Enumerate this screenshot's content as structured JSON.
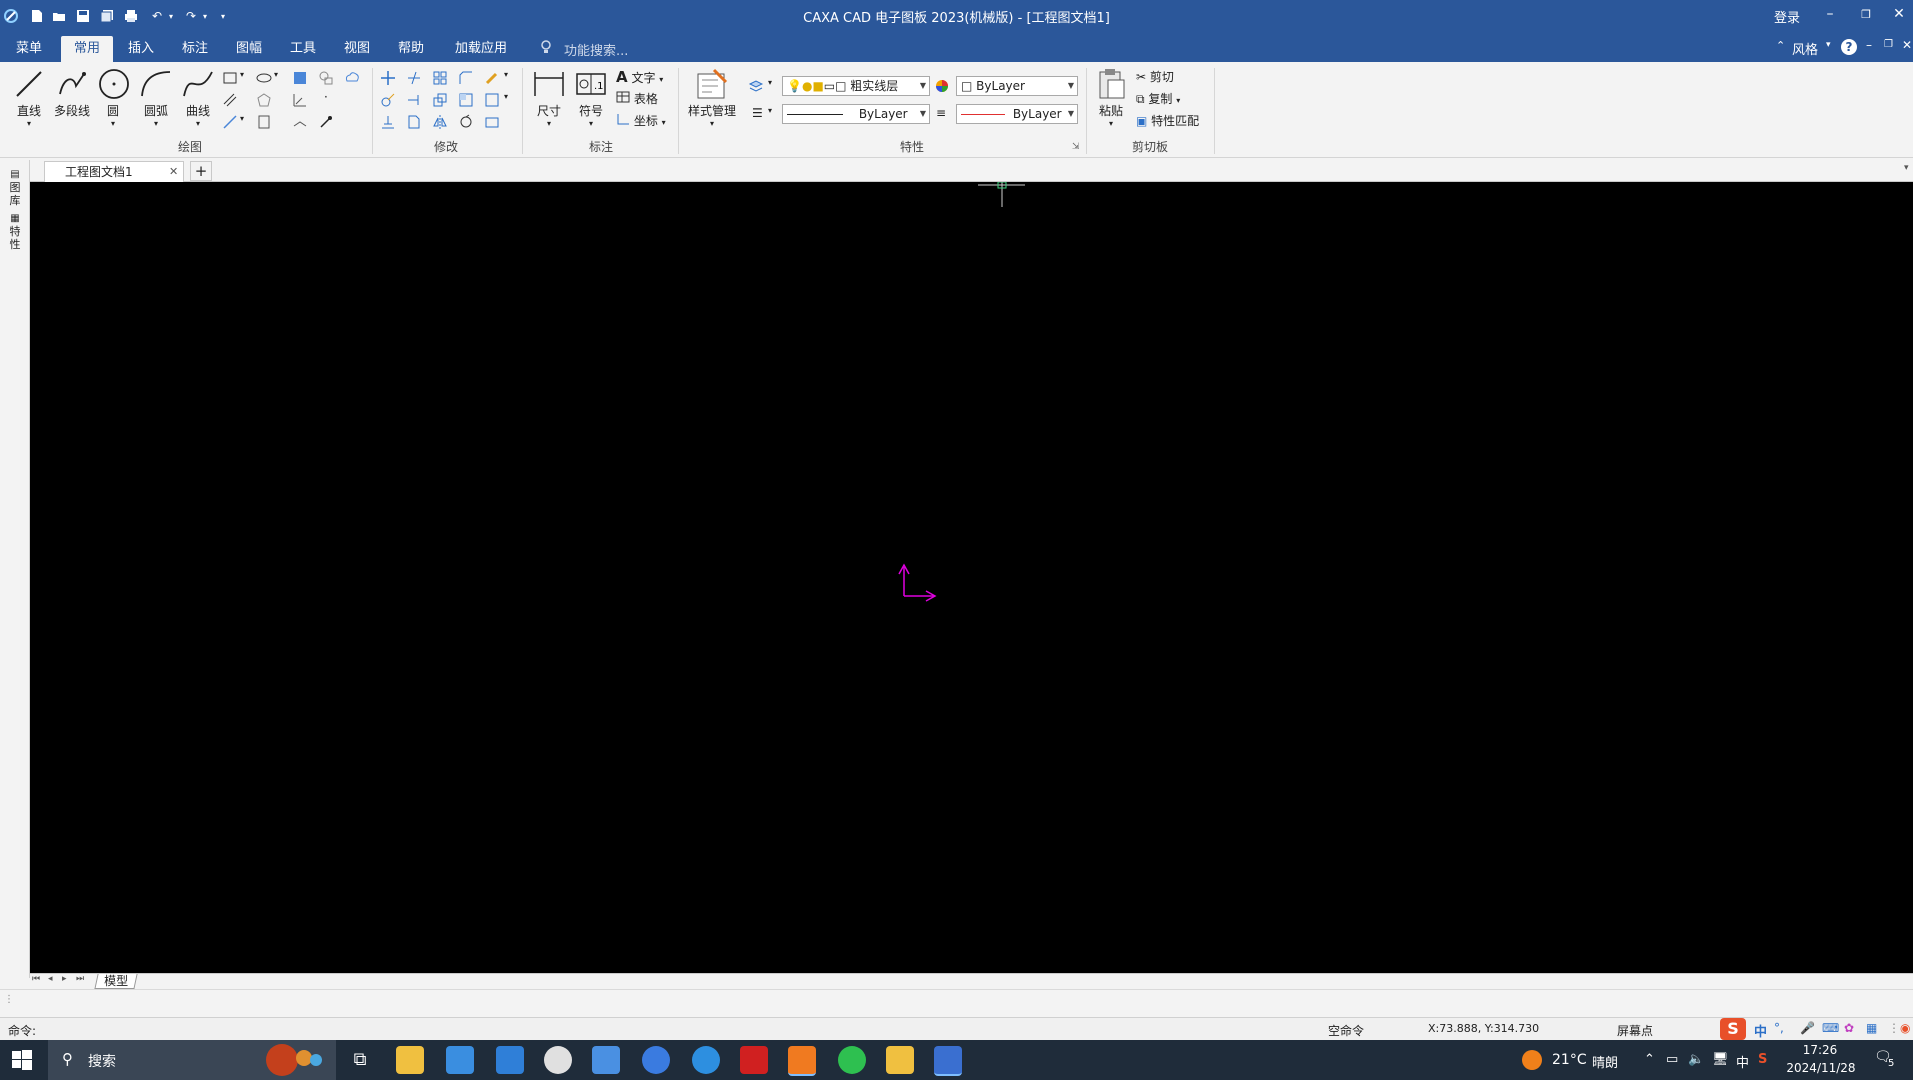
{
  "app": {
    "title": "CAXA CAD 电子图板 2023(机械版) - [工程图文档1]",
    "login": "登录",
    "window_buttons": [
      "–",
      "❐",
      "✕"
    ]
  },
  "ribbon": {
    "tabs": [
      {
        "label": "菜单"
      },
      {
        "label": "常用",
        "active": true
      },
      {
        "label": "插入"
      },
      {
        "label": "标注"
      },
      {
        "label": "图幅"
      },
      {
        "label": "工具"
      },
      {
        "label": "视图"
      },
      {
        "label": "帮助"
      },
      {
        "label": "加载应用"
      }
    ],
    "search_placeholder": "功能搜索...",
    "style_label": "风格",
    "groups": {
      "draw": {
        "label": "绘图",
        "buttons": [
          "直线",
          "多段线",
          "圆",
          "圆弧",
          "曲线"
        ]
      },
      "modify": {
        "label": "修改"
      },
      "annotate": {
        "label": "标注",
        "buttons": [
          "尺寸",
          "符号"
        ],
        "small": [
          "文字",
          "表格",
          "坐标"
        ]
      },
      "style": {
        "button": "样式管理"
      },
      "properties": {
        "label": "特性",
        "layer": "粗实线层",
        "color": "ByLayer",
        "linetype": "ByLayer",
        "lineweight": "ByLayer"
      },
      "clipboard": {
        "label": "剪切板",
        "paste": "粘贴",
        "cut": "剪切",
        "copy": "复制",
        "match": "特性匹配"
      }
    }
  },
  "document": {
    "tab_name": "工程图文档1",
    "left_rail": [
      "图库",
      "特性"
    ],
    "sheet_tab": "模型"
  },
  "command": {
    "prompt": "命令:",
    "state": "空命令",
    "coords": "X:73.888, Y:314.730",
    "snap": "屏幕点"
  },
  "taskbar": {
    "search": "搜索",
    "weather_temp": "21°C",
    "weather_desc": "晴朗",
    "ime": "中",
    "time": "17:26",
    "date": "2024/11/28",
    "notif_count": "5",
    "ime_badge": "中"
  },
  "colors": {
    "title_blue": "#2b579a",
    "canvas": "#000000",
    "ucs": "#e000e0",
    "cursor": "#3fd27f"
  }
}
